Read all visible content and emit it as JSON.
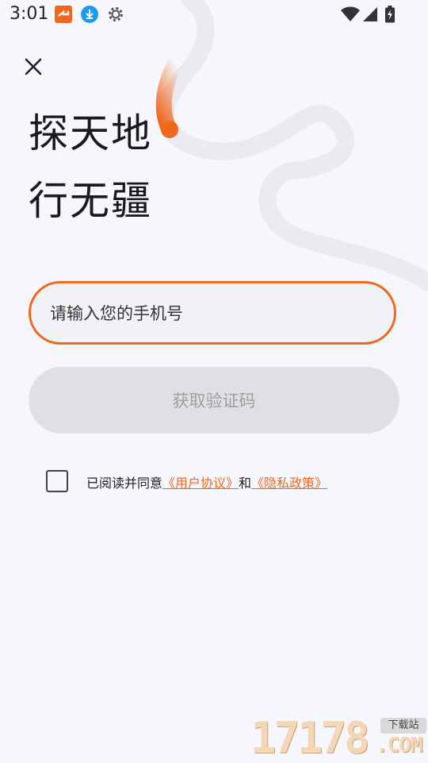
{
  "status_bar": {
    "time": "3:01",
    "icons_left": [
      "app-notification-icon",
      "download-icon",
      "settings-icon"
    ],
    "icons_right": [
      "wifi-icon",
      "signal-icon",
      "battery-charging-icon"
    ]
  },
  "headline": {
    "line1": "探天地",
    "line2": "行无疆"
  },
  "phone": {
    "placeholder": "请输入您的手机号"
  },
  "code_button": {
    "label": "获取验证码"
  },
  "agreement": {
    "prefix": "已阅读并同意",
    "user_agreement": "《用户协议》",
    "and": "和",
    "privacy_policy": "《隐私政策》"
  },
  "watermark": {
    "digits": "17178",
    "com": ".COM",
    "badge": "下载站"
  },
  "colors": {
    "accent": "#F0681E",
    "background": "#F5F7FC",
    "button_disabled": "#DFE0E4"
  }
}
